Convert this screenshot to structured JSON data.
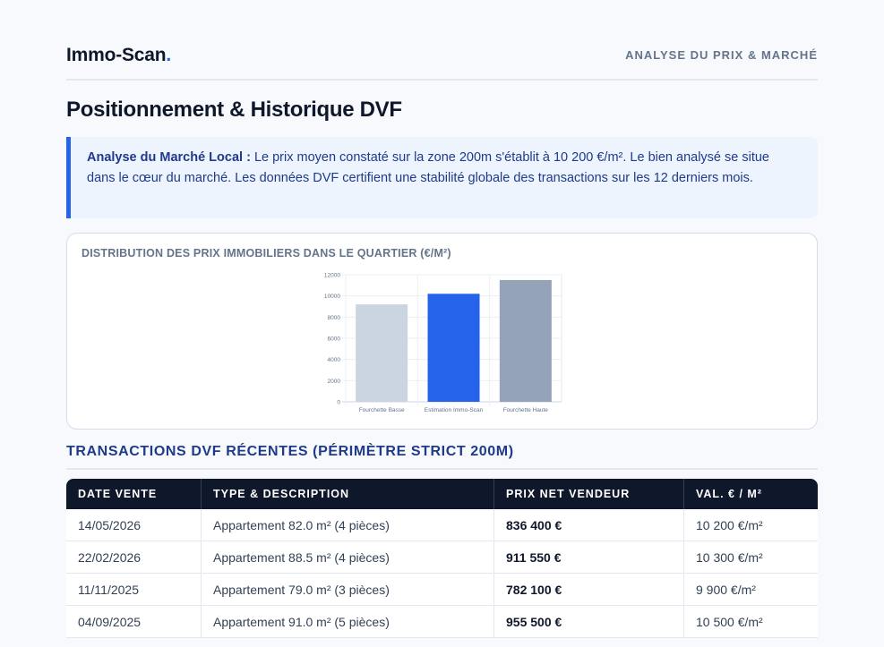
{
  "header": {
    "brand_name": "Immo-Scan",
    "brand_dot": ".",
    "section_label": "ANALYSE DU PRIX & MARCHÉ"
  },
  "page_title": "Positionnement & Historique DVF",
  "callout": {
    "label": "Analyse du Marché Local :",
    "text": " Le prix moyen constaté sur la zone 200m s'établit à 10 200 €/m². Le bien analysé se situe dans le cœur du marché. Les données DVF certifient une stabilité globale des transactions sur les 12 derniers mois."
  },
  "chart_card": {
    "heading": "DISTRIBUTION DES PRIX IMMOBILIERS DANS LE QUARTIER (€/M²)"
  },
  "chart_data": {
    "type": "bar",
    "categories": [
      "Fourchette Basse",
      "Estimation Immo-Scan",
      "Fourchette Haute"
    ],
    "values": [
      9200,
      10200,
      11500
    ],
    "ylim": [
      0,
      12000
    ],
    "yticks": [
      0,
      2000,
      4000,
      6000,
      8000,
      10000,
      12000
    ],
    "colors": [
      "#cbd5e1",
      "#2563eb",
      "#94a3b8"
    ],
    "grid": true,
    "legend": "none"
  },
  "transactions": {
    "title": "TRANSACTIONS DVF RÉCENTES (PÉRIMÈTRE STRICT 200M)",
    "columns": [
      "DATE VENTE",
      "TYPE & DESCRIPTION",
      "PRIX NET VENDEUR",
      "VAL. € / M²"
    ],
    "rows": [
      [
        "14/05/2026",
        "Appartement 82.0 m² (4 pièces)",
        "836 400 €",
        "10 200 €/m²"
      ],
      [
        "22/02/2026",
        "Appartement 88.5 m² (4 pièces)",
        "911 550 €",
        "10 300 €/m²"
      ],
      [
        "11/11/2025",
        "Appartement 79.0 m² (3 pièces)",
        "782 100 €",
        "9 900 €/m²"
      ],
      [
        "04/09/2025",
        "Appartement 91.0 m² (5 pièces)",
        "955 500 €",
        "10 500 €/m²"
      ]
    ]
  }
}
